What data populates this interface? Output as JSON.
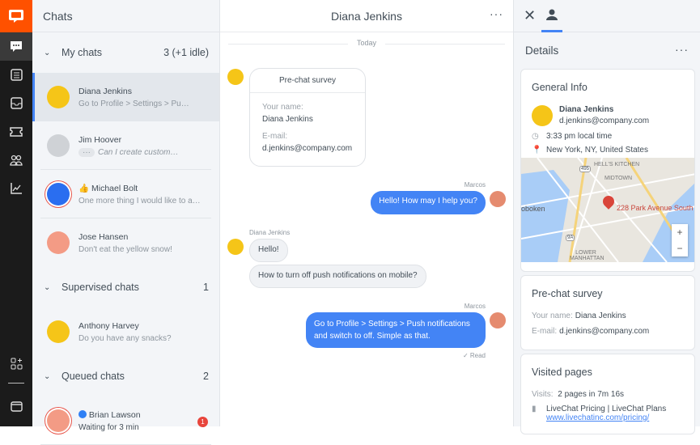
{
  "colors": {
    "brand": "#ff5100",
    "accent": "#4384f5",
    "rail": "#1b1b1b",
    "badge": "#e8453c"
  },
  "rail": {
    "icons": [
      "livechat-logo-icon",
      "chats-icon",
      "list-icon",
      "inbox-icon",
      "tickets-icon",
      "customers-icon",
      "reports-icon",
      "apps-icon",
      "billing-icon"
    ]
  },
  "list": {
    "title": "Chats",
    "my_chats": {
      "label": "My chats",
      "count": "3 (+1 idle)",
      "items": [
        {
          "name": "Diana Jenkins",
          "preview": "Go to Profile > Settings > Pu…"
        },
        {
          "name": "Jim Hoover",
          "preview": "Can I create custom…"
        },
        {
          "name": "Michael Bolt",
          "preview": "One more thing I would like to a…"
        },
        {
          "name": "Jose Hansen",
          "preview": "Don't eat the yellow snow!"
        }
      ]
    },
    "supervised": {
      "label": "Supervised chats",
      "count": "1",
      "items": [
        {
          "name": "Anthony Harvey",
          "preview": "Do you have any snacks?"
        }
      ]
    },
    "queued": {
      "label": "Queued chats",
      "count": "2",
      "items": [
        {
          "name": "Brian Lawson",
          "preview": "Waiting for 3 min",
          "badge": "1"
        }
      ]
    }
  },
  "chat": {
    "title": "Diana Jenkins",
    "date_divider": "Today",
    "survey": {
      "title": "Pre-chat survey",
      "name_label": "Your name:",
      "name": "Diana Jenkins",
      "email_label": "E-mail:",
      "email": "d.jenkins@company.com"
    },
    "messages": [
      {
        "author": "Marcos",
        "text": "Hello! How may I help you?"
      },
      {
        "author": "Diana Jenkins",
        "text": "Hello!"
      },
      {
        "text": "How to turn off push notifications on mobile?"
      },
      {
        "author": "Marcos",
        "text": "Go to Profile > Settings > Push notifications and switch to off. Simple as that.",
        "status": "Read"
      }
    ]
  },
  "details": {
    "title": "Details",
    "general": {
      "title": "General Info",
      "name": "Diana Jenkins",
      "email": "d.jenkins@company.com",
      "time": "3:33 pm local time",
      "location": "New York, NY, United States",
      "map": {
        "pin_label": "228 Park Avenue South",
        "labels": [
          "HELL'S KITCHEN",
          "MIDTOWN",
          "oboken",
          "LOWER MANHATTAN",
          "495",
          "9A"
        ],
        "zoom_in": "+",
        "zoom_out": "−"
      }
    },
    "survey": {
      "title": "Pre-chat survey",
      "name_label": "Your name:",
      "name": "Diana Jenkins",
      "email_label": "E-mail:",
      "email": "d.jenkins@company.com"
    },
    "visited": {
      "title": "Visited pages",
      "visits_label": "Visits:",
      "visits": "2 pages in 7m 16s",
      "page_title": "LiveChat Pricing | LiveChat Plans",
      "page_url": "www.livechatinc.com/pricing/"
    }
  }
}
